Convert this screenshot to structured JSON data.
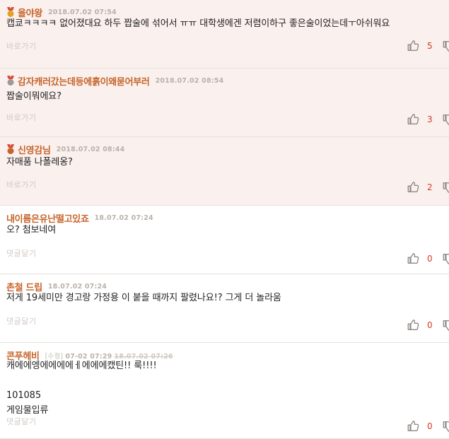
{
  "comments": [
    {
      "best": true,
      "medal": "gold",
      "nick": "올야왕",
      "date": "2018.07.02 07:54",
      "text": "캡쿄ㅋㅋㅋㅋ 없어졌대요 하두 짭술에 섞어서 ㅠㅠ 대학생에겐 저렴이하구 좋은술이었는데ㅜ아쉬워요",
      "action": "바로가기",
      "likes": "5"
    },
    {
      "best": true,
      "medal": "silver",
      "nick": "감자캐러갔는데등에흙이왜묻어부러",
      "date": "2018.07.02 08:54",
      "text": "짭술이뭐에요?",
      "action": "바로가기",
      "likes": "3"
    },
    {
      "best": true,
      "medal": "bronze",
      "nick": "신영감님",
      "date": "2018.07.02 08:44",
      "text": "자매품 나폴레옹?",
      "action": "바로가기",
      "likes": "2"
    },
    {
      "best": false,
      "nick": "내이름은유난떨고있죠",
      "date": "18.07.02 07:24",
      "text": "오? 첨보네여",
      "action": "댓글달기",
      "likes": "0"
    },
    {
      "best": false,
      "nick": "촌철 드립",
      "date": "18.07.02 07:24",
      "text": "저게 19세미만 경고랑 가정용 이 붙을 때까지 팔렸나요!? 그게 더 놀라움",
      "action": "댓글달기",
      "likes": "0"
    },
    {
      "best": false,
      "nick": "콘푸헤비",
      "edited": "[수정]",
      "date": "07-02 07:29",
      "old_date": "18.07.02 07:26",
      "text": "캐에에엥에에에에ㅔ에에에캤틴!! 룩!!!!\n\n101085\n게임물입류",
      "action": "댓글달기",
      "likes": "0"
    }
  ],
  "colors": {
    "accent": "#c6642a",
    "best_bg": "#faf0ee",
    "like_count": "#d33b22",
    "gold": "#e0a21f",
    "silver": "#9a9a9a",
    "bronze": "#c9622c"
  },
  "icons": {
    "like": "thumbs-up-icon",
    "dislike": "thumbs-down-icon",
    "medal": "medal-icon"
  }
}
